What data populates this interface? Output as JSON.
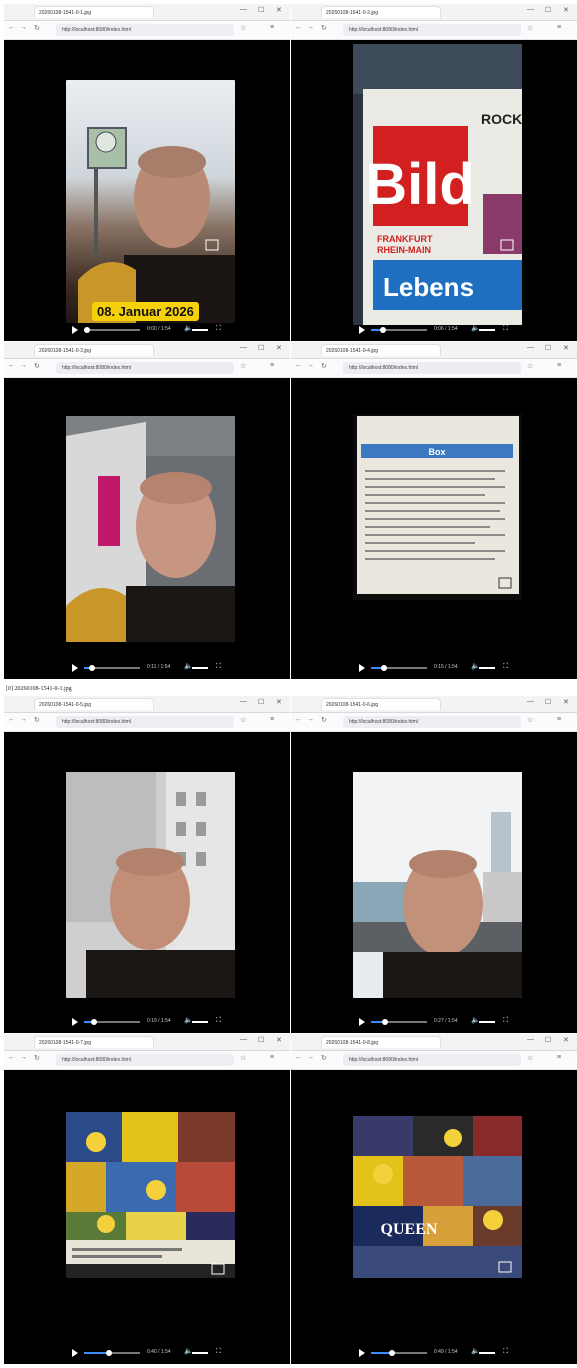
{
  "caption": "[0] 20260108-1541-0-1.jpg",
  "panels": [
    {
      "tab": "20260108-1541-0-1.jpg",
      "url": "http://localhost:8080/index.html",
      "time": "0:00 / 1:54",
      "date": "08. Januar 2026"
    },
    {
      "tab": "20260108-1541-0-2.jpg",
      "url": "http://localhost:8080/index.html",
      "time": "0:06 / 1:54",
      "newspaper": {
        "masthead": "Bild",
        "city1": "FRANKFURT",
        "city2": "RHEIN-MAIN",
        "headline": "Lebens",
        "corner": "ROCK"
      }
    },
    {
      "tab": "20260108-1541-0-3.jpg",
      "url": "http://localhost:8080/index.html",
      "time": "0:11 / 1:54"
    },
    {
      "tab": "20260108-1541-0-4.jpg",
      "url": "http://localhost:8080/index.html",
      "time": "0:15 / 1:54",
      "screen_title": "Box"
    },
    {
      "tab": "20260108-1541-0-5.jpg",
      "url": "http://localhost:8080/index.html",
      "time": "0:19 / 1:54"
    },
    {
      "tab": "20260108-1541-0-6.jpg",
      "url": "http://localhost:8080/index.html",
      "time": "0:27 / 1:54"
    },
    {
      "tab": "20260108-1541-0-7.jpg",
      "url": "http://localhost:8080/index.html",
      "time": "0:40 / 1:54"
    },
    {
      "tab": "20260108-1541-0-8.jpg",
      "url": "http://localhost:8080/index.html",
      "time": "0:49 / 1:54",
      "collage_text": "QUEEN"
    }
  ],
  "progress": [
    0.05,
    0.22,
    0.14,
    0.24,
    0.17,
    0.25,
    0.45,
    0.38
  ]
}
